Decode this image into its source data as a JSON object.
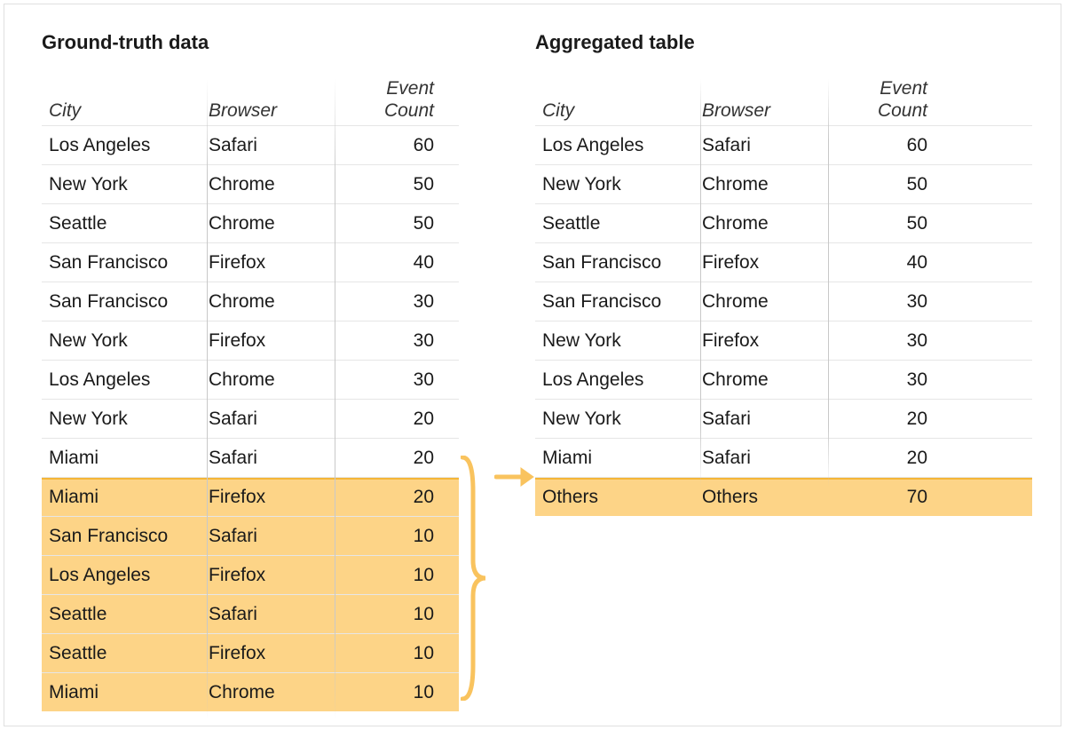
{
  "left": {
    "title": "Ground-truth data",
    "columns": {
      "c1": "City",
      "c2": "Browser",
      "c3a": "Event",
      "c3b": "Count"
    },
    "rows": [
      {
        "city": "Los Angeles",
        "browser": "Safari",
        "count": "60",
        "hl": false
      },
      {
        "city": "New York",
        "browser": "Chrome",
        "count": "50",
        "hl": false
      },
      {
        "city": "Seattle",
        "browser": "Chrome",
        "count": "50",
        "hl": false
      },
      {
        "city": "San Francisco",
        "browser": "Firefox",
        "count": "40",
        "hl": false
      },
      {
        "city": "San Francisco",
        "browser": "Chrome",
        "count": "30",
        "hl": false
      },
      {
        "city": "New York",
        "browser": "Firefox",
        "count": "30",
        "hl": false
      },
      {
        "city": "Los Angeles",
        "browser": "Chrome",
        "count": "30",
        "hl": false
      },
      {
        "city": "New York",
        "browser": "Safari",
        "count": "20",
        "hl": false
      },
      {
        "city": "Miami",
        "browser": "Safari",
        "count": "20",
        "hl": false
      },
      {
        "city": "Miami",
        "browser": "Firefox",
        "count": "20",
        "hl": true
      },
      {
        "city": "San Francisco",
        "browser": "Safari",
        "count": "10",
        "hl": true
      },
      {
        "city": "Los Angeles",
        "browser": "Firefox",
        "count": "10",
        "hl": true
      },
      {
        "city": "Seattle",
        "browser": "Safari",
        "count": "10",
        "hl": true
      },
      {
        "city": "Seattle",
        "browser": "Firefox",
        "count": "10",
        "hl": true
      },
      {
        "city": "Miami",
        "browser": "Chrome",
        "count": "10",
        "hl": true
      }
    ]
  },
  "right": {
    "title": "Aggregated table",
    "columns": {
      "c1": "City",
      "c2": "Browser",
      "c3a": "Event",
      "c3b": "Count"
    },
    "rows": [
      {
        "city": "Los Angeles",
        "browser": "Safari",
        "count": "60",
        "hl": false
      },
      {
        "city": "New York",
        "browser": "Chrome",
        "count": "50",
        "hl": false
      },
      {
        "city": "Seattle",
        "browser": "Chrome",
        "count": "50",
        "hl": false
      },
      {
        "city": "San Francisco",
        "browser": "Firefox",
        "count": "40",
        "hl": false
      },
      {
        "city": "San Francisco",
        "browser": "Chrome",
        "count": "30",
        "hl": false
      },
      {
        "city": "New York",
        "browser": "Firefox",
        "count": "30",
        "hl": false
      },
      {
        "city": "Los Angeles",
        "browser": "Chrome",
        "count": "30",
        "hl": false
      },
      {
        "city": "New York",
        "browser": "Safari",
        "count": "20",
        "hl": false
      },
      {
        "city": "Miami",
        "browser": "Safari",
        "count": "20",
        "hl": false
      },
      {
        "city": "Others",
        "browser": "Others",
        "count": "70",
        "hl": true
      }
    ]
  },
  "colors": {
    "highlight": "#fdd487",
    "arrow": "#f9c35e"
  }
}
